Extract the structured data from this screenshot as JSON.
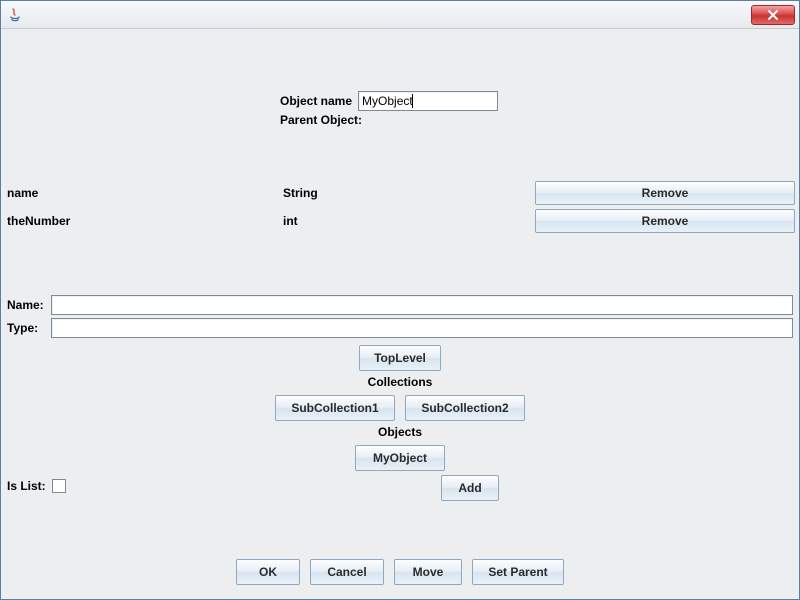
{
  "header": {
    "object_name_label": "Object name",
    "object_name_value": "MyObject",
    "parent_object_label": "Parent Object:"
  },
  "fields": [
    {
      "name": "name",
      "type": "String",
      "remove_label": "Remove"
    },
    {
      "name": "theNumber",
      "type": "int",
      "remove_label": "Remove"
    }
  ],
  "form": {
    "name_label": "Name:",
    "name_value": "",
    "type_label": "Type:",
    "type_value": ""
  },
  "toplevel_label": "TopLevel",
  "collections_heading": "Collections",
  "collections": [
    {
      "label": "SubCollection1"
    },
    {
      "label": "SubCollection2"
    }
  ],
  "objects_heading": "Objects",
  "objects": [
    {
      "label": "MyObject"
    }
  ],
  "add_label": "Add",
  "is_list_label": "Is List:",
  "is_list_checked": false,
  "bottom": {
    "ok": "OK",
    "cancel": "Cancel",
    "move": "Move",
    "set_parent": "Set Parent"
  }
}
